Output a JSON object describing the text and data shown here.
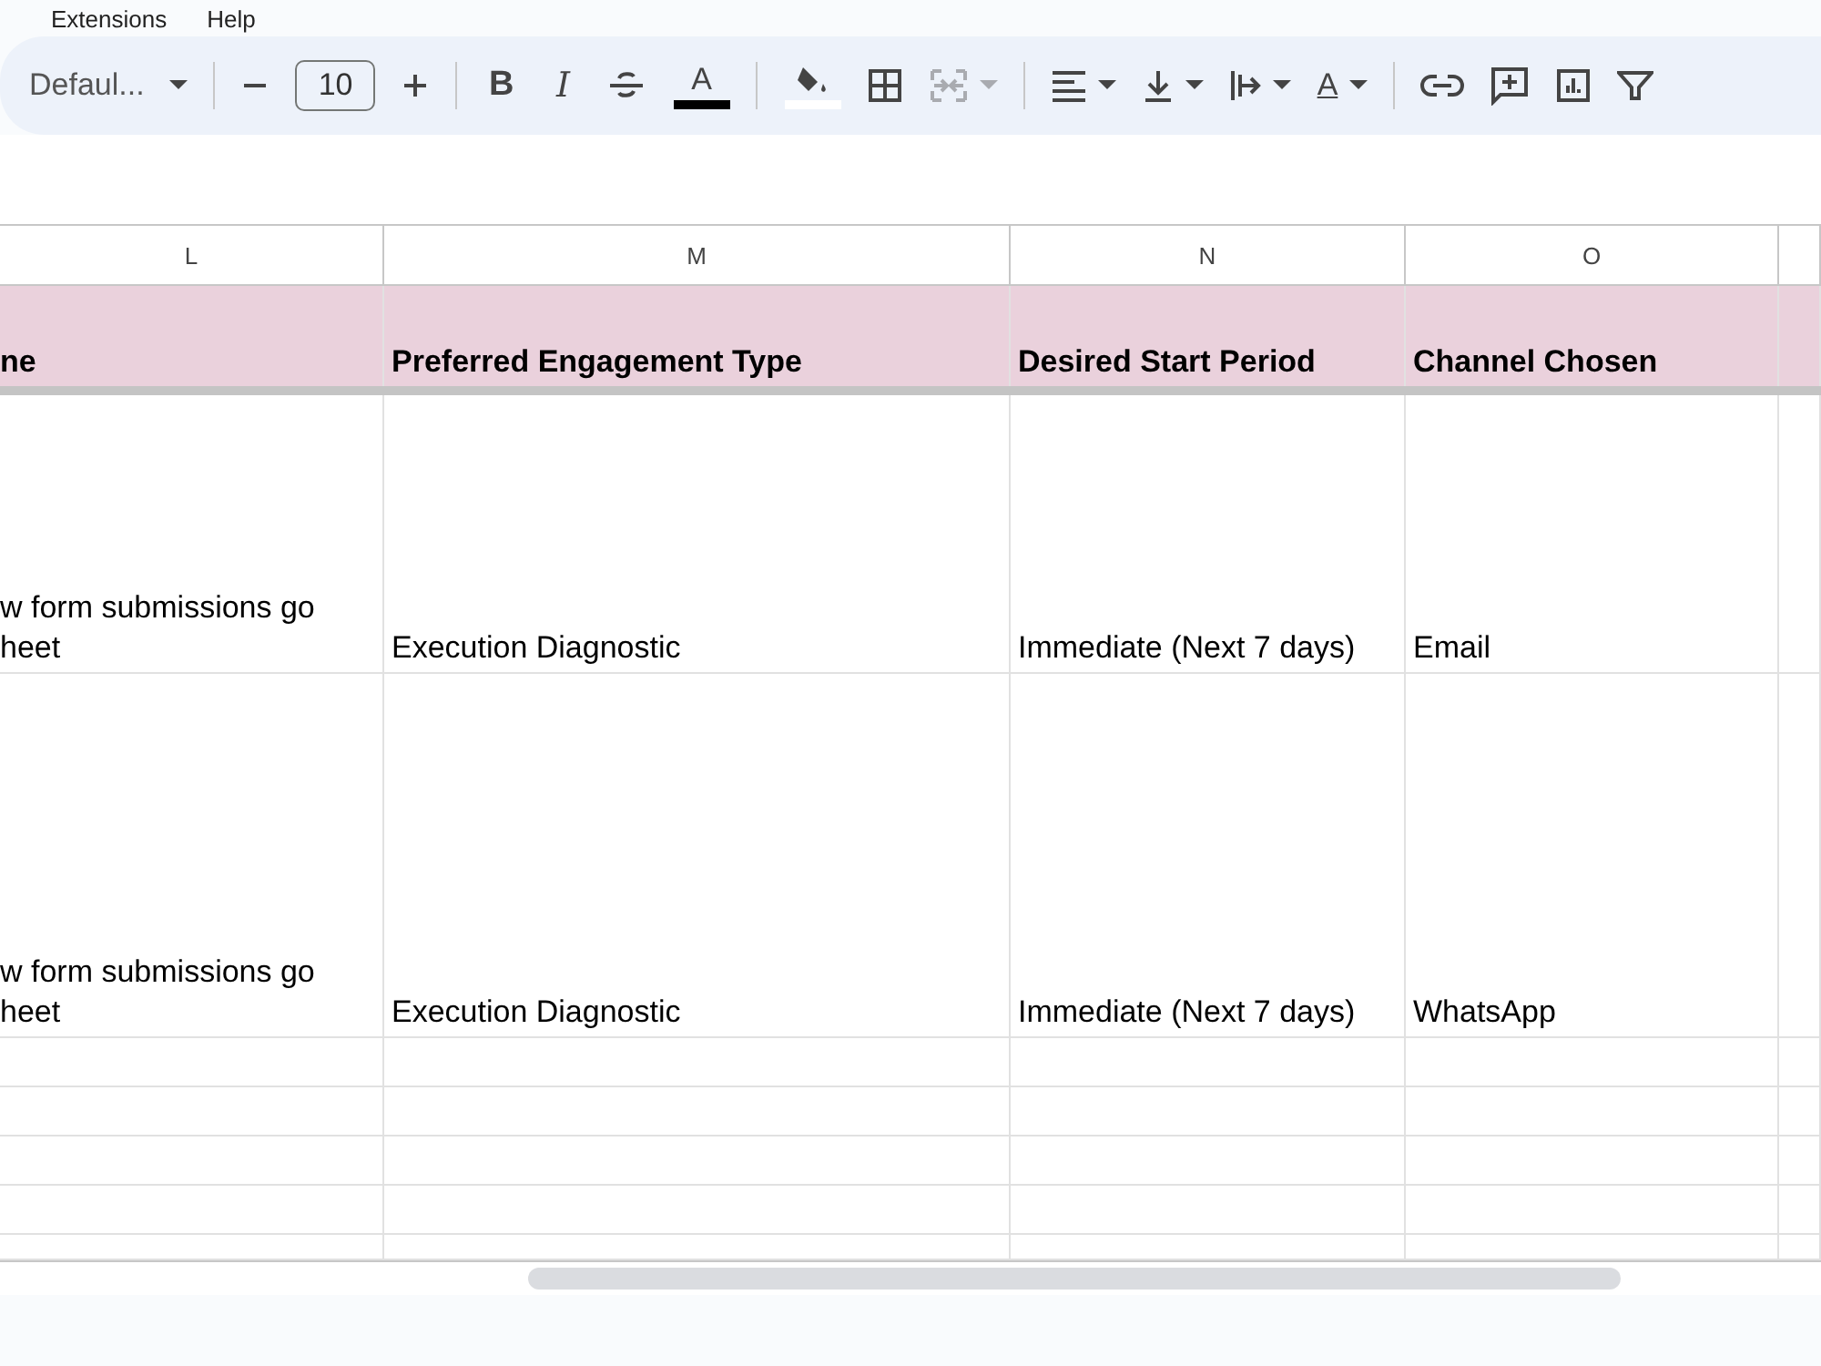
{
  "menu": [
    "Extensions",
    "Help"
  ],
  "toolbar": {
    "font": "Defaul...",
    "font_size": "10",
    "bold": "B",
    "italic": "I",
    "text_color": {
      "label": "A",
      "color": "#000000"
    },
    "fill_color": {
      "color": "#ffffff"
    },
    "merge_disabled": true,
    "rotate": "A"
  },
  "columns": [
    "L",
    "M",
    "N",
    "O"
  ],
  "header_row": [
    "ne",
    "Preferred Engagement Type",
    "Desired Start Period",
    "Channel Chosen"
  ],
  "rows": [
    {
      "cells": [
        "w form submissions go\nheet",
        "Execution Diagnostic",
        "Immediate (Next 7 days)",
        "Email"
      ]
    },
    {
      "cells": [
        "w form submissions go\nheet",
        "Execution Diagnostic",
        "Immediate (Next 7 days)",
        "WhatsApp"
      ]
    }
  ]
}
